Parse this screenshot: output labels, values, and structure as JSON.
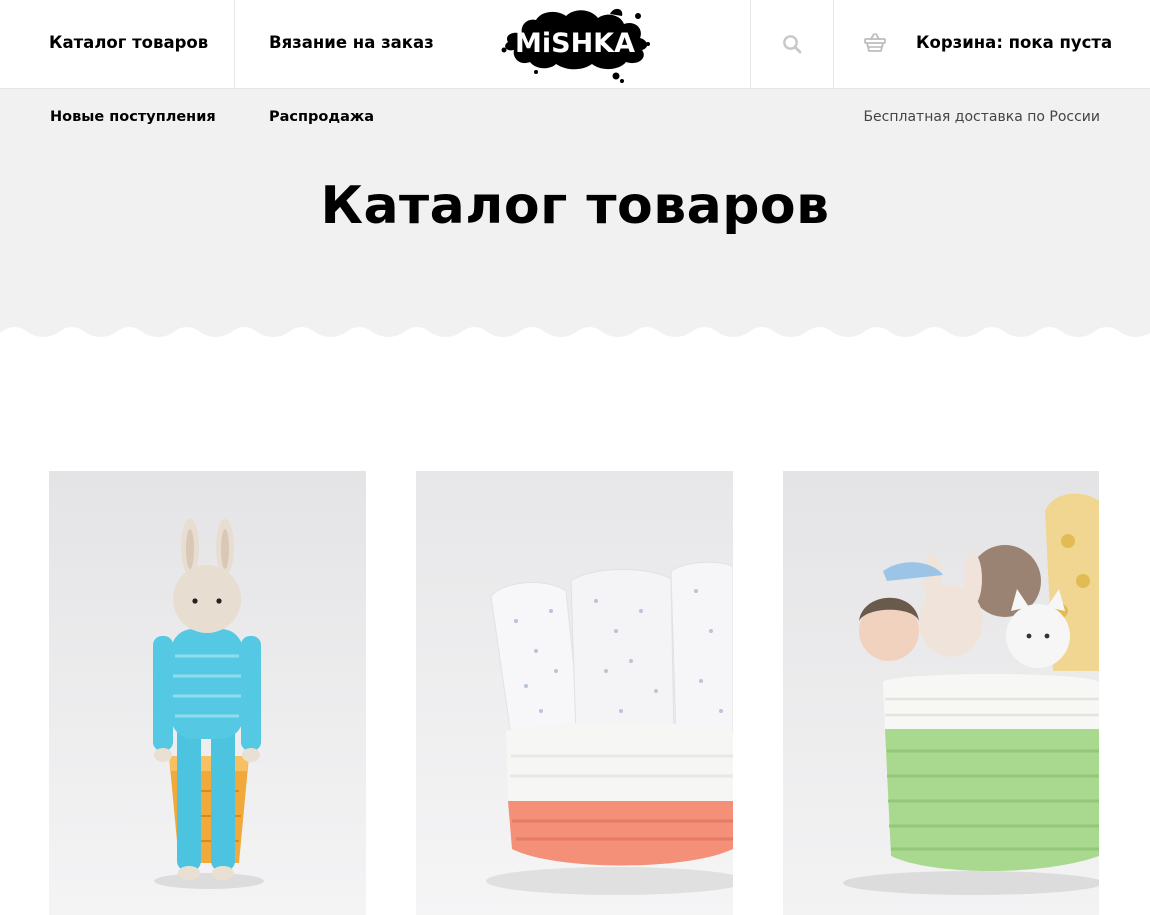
{
  "header": {
    "nav_catalog": "Каталог товаров",
    "nav_knitting": "Вязание на заказ",
    "logo_text": "MiSHKA",
    "cart_label": "Корзина: пока пуста"
  },
  "subnav": {
    "new_arrivals": "Новые поступления",
    "sale": "Распродажа",
    "delivery_note": "Бесплатная доставка по России"
  },
  "page": {
    "title": "Каталог товаров"
  },
  "products": [
    {
      "icon": "crochet-bunny-toy-image"
    },
    {
      "icon": "crochet-basket-with-diapers-image"
    },
    {
      "icon": "crochet-basket-with-toys-image"
    }
  ],
  "colors": {
    "hero_bg": "#f1f1f1",
    "header_border": "#e6e6e6",
    "text": "#000000",
    "muted_text": "#444444"
  }
}
